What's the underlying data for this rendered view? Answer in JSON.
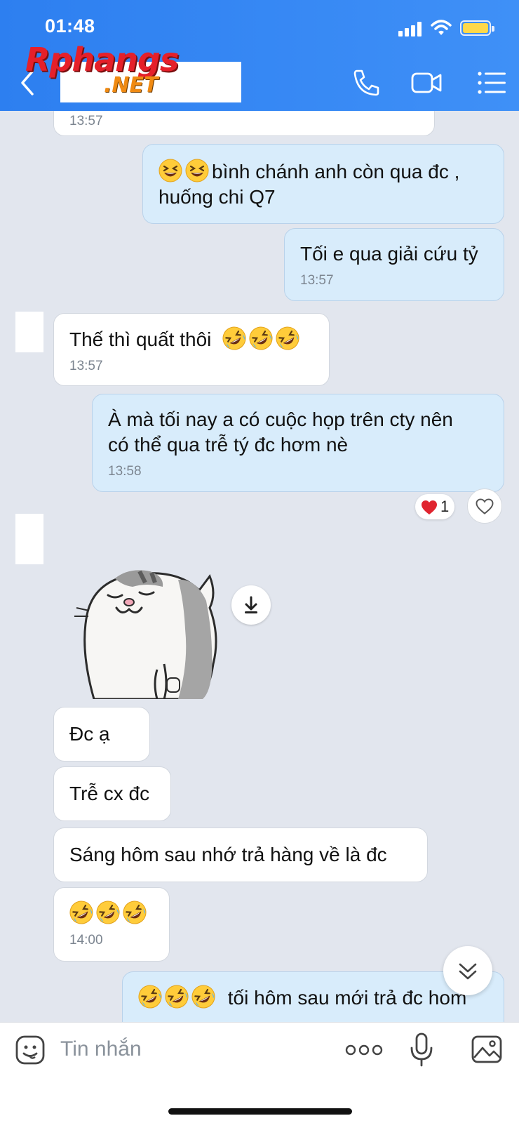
{
  "status_bar": {
    "time": "01:48"
  },
  "header": {
    "logo_text_1": "Rphangs",
    "logo_text_2": ".NET",
    "icons": [
      "back-chevron-icon",
      "phone-icon",
      "video-camera-icon",
      "list-menu-icon"
    ]
  },
  "messages": {
    "m0": {
      "time": "13:57"
    },
    "m1": {
      "emoji": "grinning-squint-face",
      "text_line1": "bình chánh anh còn qua đc ,",
      "text_line2": "huống chi Q7"
    },
    "m2": {
      "text": "Tối e qua giải cứu tỷ",
      "time": "13:57"
    },
    "m3": {
      "text": "Thế thì quất thôi",
      "emoji": "rolling-on-floor-laughing",
      "time": "13:57"
    },
    "m4": {
      "text_line1": "À mà tối nay a có cuộc họp trên cty nên",
      "text_line2": "có thể qua trễ tý đc hơm nè",
      "time": "13:58",
      "reaction_count": "1"
    },
    "m5": {
      "sticker": "grey-cat-sticker"
    },
    "m6": {
      "text": "Đc ạ"
    },
    "m7": {
      "text": "Trễ cx đc"
    },
    "m8": {
      "text": "Sáng hôm sau nhớ trả hàng về là đc"
    },
    "m9": {
      "emoji": "rolling-on-floor-laughing",
      "time": "14:00"
    },
    "m10": {
      "text": "tối hôm sau mới trả đc hom",
      "emoji": "rolling-on-floor-laughing"
    }
  },
  "input_bar": {
    "placeholder": "Tin nhắn",
    "icons": [
      "sticker-icon",
      "more-options-icon",
      "microphone-icon",
      "image-icon"
    ]
  },
  "colors": {
    "header_blue": "#3088f3",
    "chat_background": "#e2e6ee",
    "outgoing_bubble": "#d8ecfb",
    "incoming_bubble": "#ffffff",
    "battery_yellow": "#ffd84a",
    "heart_red": "#e0242f"
  }
}
